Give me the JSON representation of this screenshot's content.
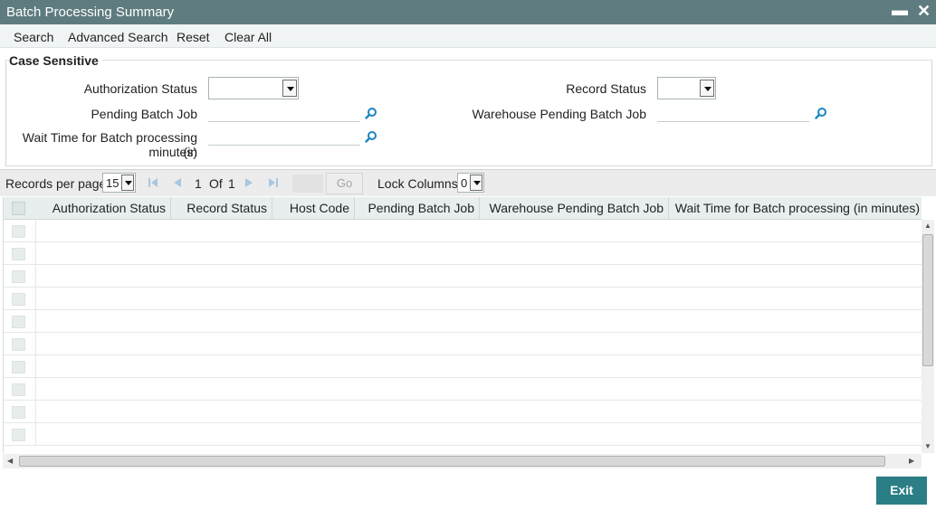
{
  "window": {
    "title": "Batch Processing Summary",
    "minimize_glyph": "▬",
    "close_glyph": "✕"
  },
  "toolbar": {
    "items": [
      "Search",
      "Advanced Search",
      "Reset",
      "Clear All"
    ]
  },
  "criteria": {
    "legend": "Case Sensitive",
    "authorization_status_label": "Authorization Status",
    "authorization_status_value": "",
    "record_status_label": "Record Status",
    "record_status_value": "",
    "pending_batch_job_label": "Pending Batch Job",
    "pending_batch_job_value": "",
    "warehouse_pending_batch_job_label": "Warehouse Pending Batch Job",
    "warehouse_pending_batch_job_value": "",
    "wait_time_label_line1": "Wait Time for Batch processing (in",
    "wait_time_label_line2": "minutes)",
    "wait_time_value": ""
  },
  "pager": {
    "records_per_page_label": "Records per page",
    "records_per_page_value": "15",
    "current_page": "1",
    "of_label": "Of",
    "total_pages": "1",
    "go_label": "Go",
    "lock_columns_label": "Lock Columns",
    "lock_columns_value": "0"
  },
  "grid": {
    "columns": [
      "Authorization Status",
      "Record Status",
      "Host Code",
      "Pending Batch Job",
      "Warehouse Pending Batch Job",
      "Wait Time for Batch processing (in minutes)"
    ],
    "rows": [
      [],
      [],
      [],
      [],
      [],
      [],
      [],
      [],
      [],
      []
    ]
  },
  "footer": {
    "exit_label": "Exit"
  },
  "colors": {
    "title_bar": "#5e7c7f",
    "exit_button": "#2b7e86",
    "search_icon": "#1b85c2"
  }
}
